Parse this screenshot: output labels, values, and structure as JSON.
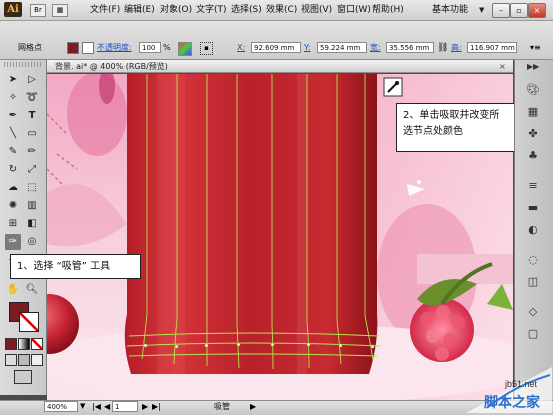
{
  "app": {
    "logo_text": "Ai",
    "workspace_label": "基本功能",
    "window_controls": [
      "minimize",
      "restore",
      "close"
    ]
  },
  "menu": {
    "items": [
      "文件(F)",
      "编辑(E)",
      "对象(O)",
      "文字(T)",
      "选择(S)",
      "效果(C)",
      "视图(V)",
      "窗口(W)",
      "帮助(H)"
    ]
  },
  "control_bar": {
    "selection_label": "网格点",
    "opacity_label": "不透明度:",
    "opacity_value": "100",
    "percent": "%",
    "x_label": "X:",
    "x_value": "92.609 mm",
    "y_label": "Y:",
    "y_value": "59.224 mm",
    "w_label": "宽:",
    "w_value": "35.556 mm",
    "h_label": "高:",
    "h_value": "116.907 mm",
    "colors": {
      "fill": "#7b1c23",
      "stroke": "#ffffff"
    }
  },
  "document": {
    "tab_title": "背景. ai* @ 400% (RGB/预览)",
    "close_label": "×"
  },
  "tools": {
    "active_tool": "eyedropper",
    "fill_color": "#7b1c23",
    "stroke_color": "#ffffff"
  },
  "status": {
    "zoom": "400%",
    "page": "1",
    "tool_name": "吸管"
  },
  "annotations": {
    "callout_1": "1、选择 “吸管” 工具",
    "callout_2_line1": "2、单击吸取并改变所",
    "callout_2_line2": "选节点处颜色"
  },
  "watermark": {
    "site": "jb51.net",
    "name": "脚本之家"
  }
}
